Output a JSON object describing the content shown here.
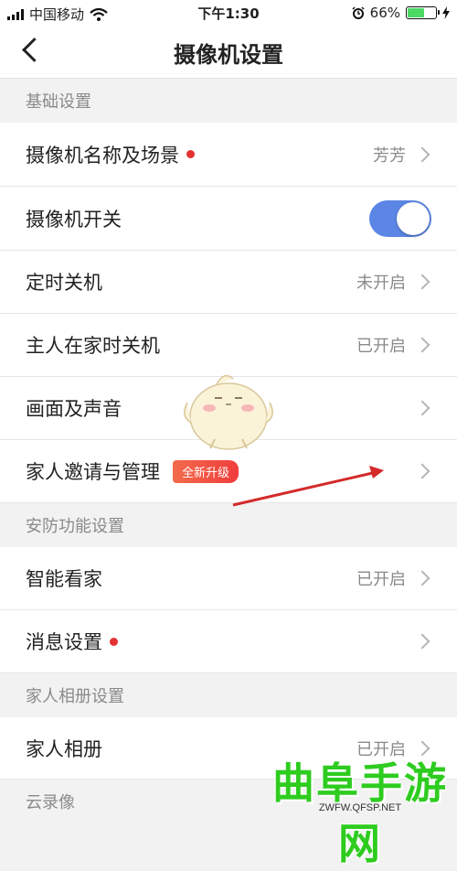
{
  "status_bar": {
    "carrier": "中国移动",
    "time": "下午1:30",
    "battery_percent": "66%",
    "battery_level": 0.66,
    "icons": [
      "signal-icon",
      "wifi-icon",
      "alarm-icon",
      "battery-icon",
      "charging-icon"
    ]
  },
  "nav": {
    "title": "摄像机设置",
    "back_icon": "back-chevron-icon"
  },
  "sections": {
    "basic": "基础设置",
    "security": "安防功能设置",
    "album": "家人相册设置",
    "cloud": "云录像"
  },
  "rows": {
    "camera_name": {
      "label": "摄像机名称及场景",
      "value": "芳芳"
    },
    "camera_switch": {
      "label": "摄像机开关",
      "on": true
    },
    "timer_off": {
      "label": "定时关机",
      "value": "未开启"
    },
    "home_off": {
      "label": "主人在家时关机",
      "value": "已开启"
    },
    "picture_sound": {
      "label": "画面及声音"
    },
    "family_invite": {
      "label": "家人邀请与管理",
      "badge": "全新升级"
    },
    "smart_guard": {
      "label": "智能看家",
      "value": "已开启"
    },
    "message_settings": {
      "label": "消息设置"
    },
    "family_album": {
      "label": "家人相册",
      "value": "已开启"
    }
  },
  "colors": {
    "accent": "#5b86e5",
    "red_dot": "#e33232",
    "badge": "#f23d3d",
    "annotation_arrow": "#d42a2a"
  },
  "watermark": {
    "text": "曲阜手游网",
    "url": "ZWFW.QFSP.NET"
  }
}
